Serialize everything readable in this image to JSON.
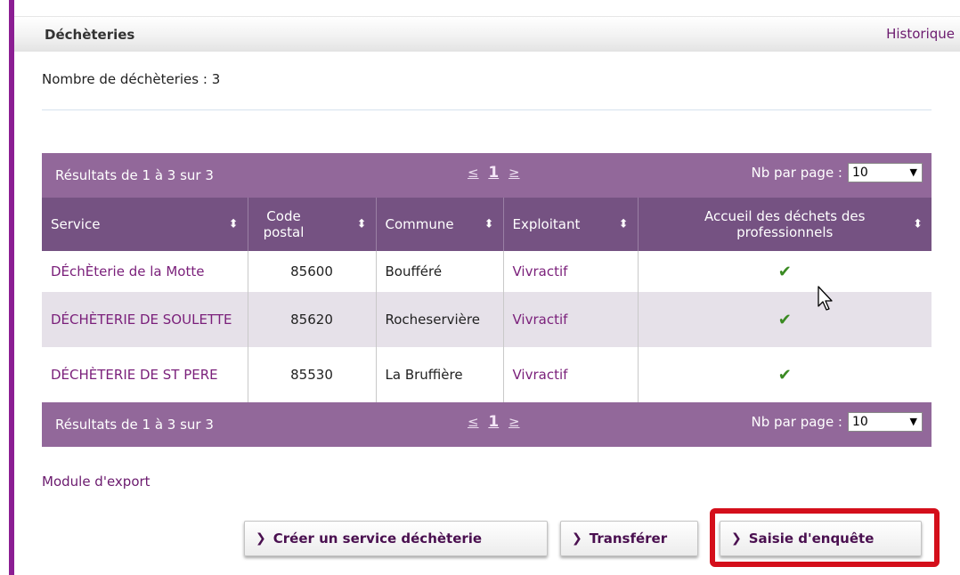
{
  "panel": {
    "title": "Déchèteries",
    "history_link": "Historique",
    "count_label": "Nombre de déchèteries : 3"
  },
  "pager": {
    "summary": "Résultats de 1 à 3 sur 3",
    "prev": "≤",
    "page": "1",
    "next": "≥",
    "per_page_label": "Nb par page :",
    "per_page_value": "10"
  },
  "table": {
    "headers": {
      "service": "Service",
      "code_postal": "Code postal",
      "commune": "Commune",
      "exploitant": "Exploitant",
      "accueil": "Accueil des déchets des professionnels"
    },
    "rows": [
      {
        "service": "DÉchÈterie de la Motte",
        "code_postal": "85600",
        "commune": "Boufféré",
        "exploitant": "Vivractif",
        "accueil": "✔"
      },
      {
        "service": "DÉCHÈTERIE DE SOULETTE",
        "code_postal": "85620",
        "commune": "Rocheservière",
        "exploitant": "Vivractif",
        "accueil": "✔"
      },
      {
        "service": "DÉCHÈTERIE DE ST PERE",
        "code_postal": "85530",
        "commune": "La Bruffière",
        "exploitant": "Vivractif",
        "accueil": "✔"
      }
    ]
  },
  "export_link": "Module d'export",
  "buttons": {
    "create": "Créer un service déchèterie",
    "transfer": "Transférer",
    "survey": "Saisie d'enquête"
  },
  "colors": {
    "accent_bar": "#8b1e93",
    "pager_bg": "#92689a",
    "header_bg": "#755282",
    "highlight": "#d40f1b"
  }
}
